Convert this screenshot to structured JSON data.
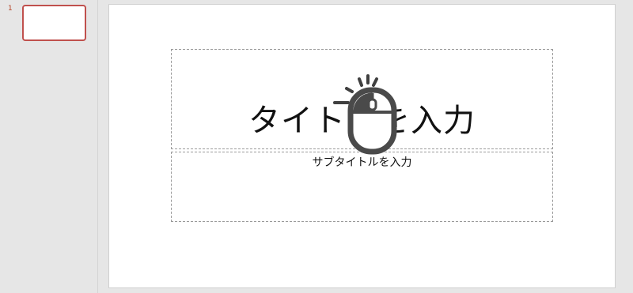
{
  "thumbnails": [
    {
      "number": "1"
    }
  ],
  "slide": {
    "title_placeholder": "タイトルを入力",
    "subtitle_placeholder": "サブタイトルを入力"
  },
  "overlay": {
    "icon": "mouse-click-icon"
  },
  "colors": {
    "selection": "#c0504d",
    "background": "#e6e6e6"
  }
}
